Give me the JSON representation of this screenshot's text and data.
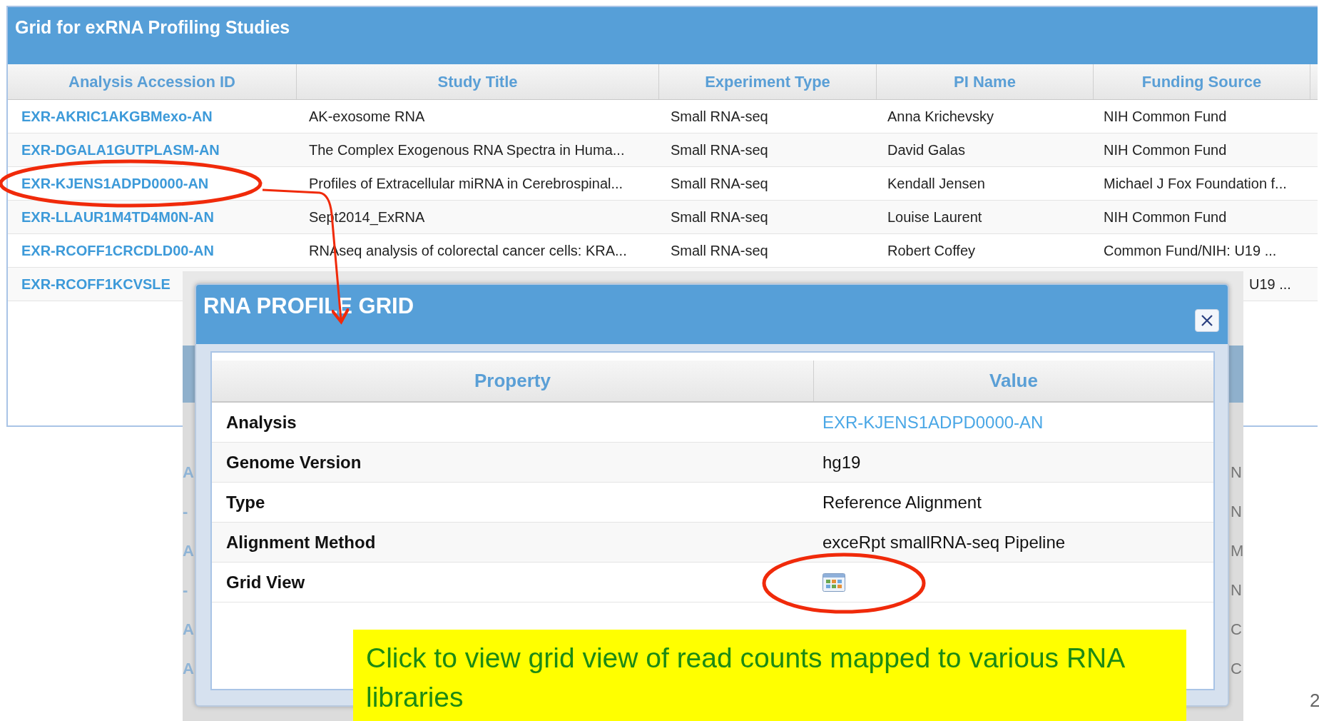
{
  "grid": {
    "title": "Grid for exRNA Profiling Studies",
    "columns": [
      "Analysis Accession ID",
      "Study Title",
      "Experiment Type",
      "PI Name",
      "Funding Source"
    ],
    "rows": [
      {
        "id": "EXR-AKRIC1AKGBMexo-AN",
        "title": "AK-exosome RNA",
        "type": "Small RNA-seq",
        "pi": "Anna Krichevsky",
        "funding": "NIH Common Fund"
      },
      {
        "id": "EXR-DGALA1GUTPLASM-AN",
        "title": "The Complex Exogenous RNA Spectra in Huma...",
        "type": "Small RNA-seq",
        "pi": "David Galas",
        "funding": "NIH Common Fund"
      },
      {
        "id": "EXR-KJENS1ADPD0000-AN",
        "title": "Profiles of Extracellular miRNA in Cerebrospinal...",
        "type": "Small RNA-seq",
        "pi": "Kendall Jensen",
        "funding": "Michael J Fox Foundation f..."
      },
      {
        "id": "EXR-LLAUR1M4TD4M0N-AN",
        "title": "Sept2014_ExRNA",
        "type": "Small RNA-seq",
        "pi": "Louise Laurent",
        "funding": "NIH Common Fund"
      },
      {
        "id": "EXR-RCOFF1CRCDLD00-AN",
        "title": "RNAseq analysis of colorectal cancer cells: KRA...",
        "type": "Small RNA-seq",
        "pi": "Robert Coffey",
        "funding": "Common Fund/NIH: U19 ..."
      },
      {
        "id": "EXR-RCOFF1KCVSLE",
        "funding": "U19 ..."
      }
    ]
  },
  "background_panel": {
    "left_fragments": [
      "A",
      "-",
      "A",
      "-",
      "A",
      "A"
    ],
    "right_fragments": [
      "N",
      "N",
      "M",
      "N",
      "C",
      "C"
    ]
  },
  "dialog": {
    "title": "RNA PROFILE GRID",
    "columns": [
      "Property",
      "Value"
    ],
    "rows": [
      {
        "property": "Analysis",
        "kind": "link",
        "value": "EXR-KJENS1ADPD0000-AN"
      },
      {
        "property": "Genome Version",
        "kind": "text",
        "value": "hg19"
      },
      {
        "property": "Type",
        "kind": "text",
        "value": "Reference Alignment"
      },
      {
        "property": "Alignment Method",
        "kind": "text",
        "value": "exceRpt smallRNA-seq Pipeline"
      },
      {
        "property": "Grid View",
        "kind": "icon"
      }
    ]
  },
  "callout": "Click to view grid view of read counts mapped to various RNA libraries",
  "slide_number": "2"
}
